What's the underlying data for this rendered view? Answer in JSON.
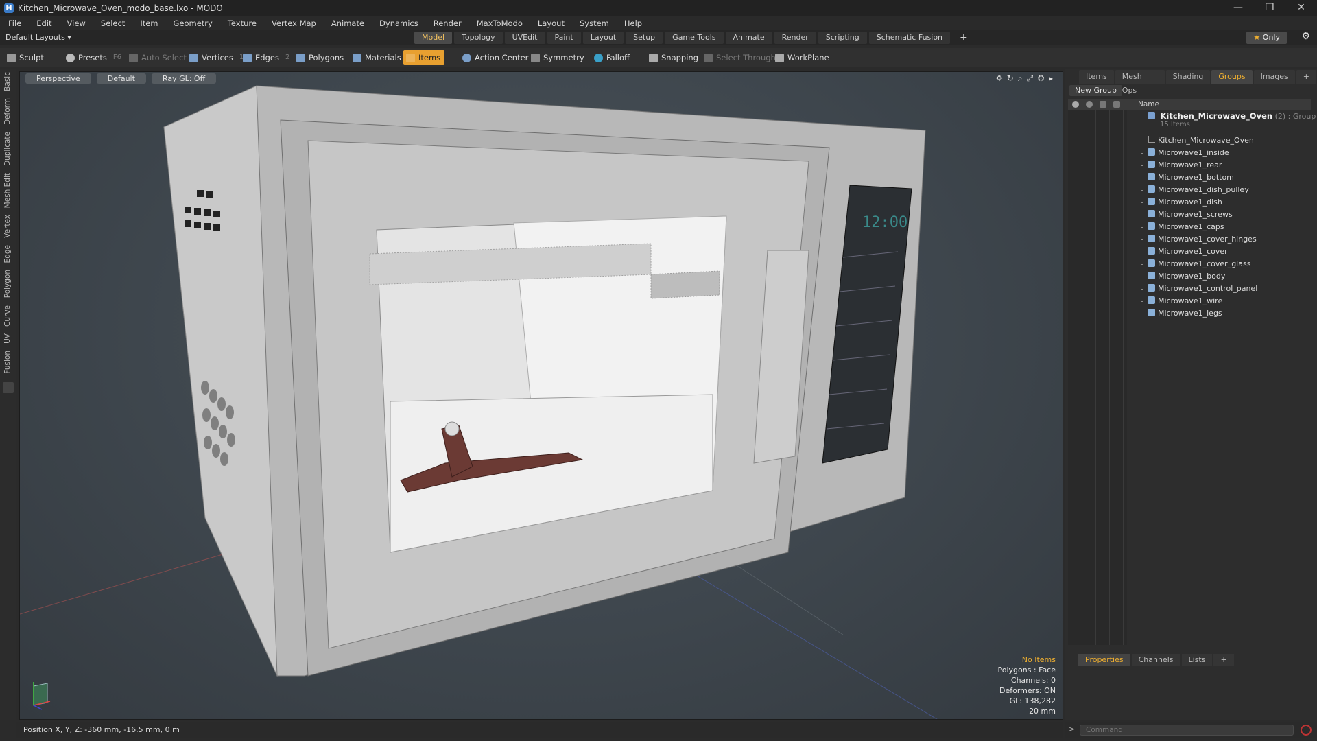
{
  "titlebar": {
    "title": "Kitchen_Microwave_Oven_modo_base.lxo - MODO",
    "min": "—",
    "max": "❐",
    "close": "✕"
  },
  "menubar": [
    "File",
    "Edit",
    "View",
    "Select",
    "Item",
    "Geometry",
    "Texture",
    "Vertex Map",
    "Animate",
    "Dynamics",
    "Render",
    "MaxToModo",
    "Layout",
    "System",
    "Help"
  ],
  "layoutbar": {
    "layout_select": "Default Layouts ▾",
    "tabs": [
      "Model",
      "Topology",
      "UVEdit",
      "Paint",
      "Layout",
      "Setup",
      "Game Tools",
      "Animate",
      "Render",
      "Scripting",
      "Schematic Fusion"
    ],
    "active_tab": "Model",
    "add": "+",
    "only_star": "★",
    "only_label": "Only",
    "gear": "⚙"
  },
  "toolbar": {
    "sculpt": "Sculpt",
    "presets": "Presets",
    "presets_key": "F6",
    "auto_select": "Auto Select",
    "vertices": "Vertices",
    "vertices_key": "1",
    "edges": "Edges",
    "edges_key": "2",
    "polygons": "Polygons",
    "materials": "Materials",
    "items": "Items",
    "action_center": "Action Center",
    "symmetry": "Symmetry",
    "falloff": "Falloff",
    "snapping": "Snapping",
    "select_through": "Select Through",
    "workplane": "WorkPlane"
  },
  "left_tabs": [
    "Basic",
    "Deform",
    "Duplicate",
    "Mesh Edit",
    "Vertex",
    "Edge",
    "Polygon",
    "Curve",
    "UV",
    "Fusion"
  ],
  "viewport": {
    "view": "Perspective",
    "shading": "Default",
    "raygl": "Ray GL: Off",
    "icons": [
      "✥",
      "↻",
      "⌕",
      "⤢",
      "⚙",
      "▸"
    ],
    "display_clock": "12:00",
    "stats": {
      "selection": "No Items",
      "polygons": "Polygons : Face",
      "channels": "Channels: 0",
      "deformers": "Deformers: ON",
      "gl": "GL: 138,282",
      "scale": "20 mm"
    }
  },
  "statusbar": {
    "position": "Position X, Y, Z:  -360 mm, -16.5 mm, 0 m"
  },
  "right_panel": {
    "tabs": [
      "Items",
      "Mesh Ops",
      "Shading",
      "Groups",
      "Images",
      "+"
    ],
    "active_tab": "Groups",
    "new_group": "New Group",
    "column_name": "Name",
    "group": {
      "name": "Kitchen_Microwave_Oven",
      "count_suffix": "(2)",
      "type": ": Group",
      "items": "15 Items"
    },
    "items": [
      "Kitchen_Microwave_Oven",
      "Microwave1_inside",
      "Microwave1_rear",
      "Microwave1_bottom",
      "Microwave1_dish_pulley",
      "Microwave1_dish",
      "Microwave1_screws",
      "Microwave1_caps",
      "Microwave1_cover_hinges",
      "Microwave1_cover",
      "Microwave1_cover_glass",
      "Microwave1_body",
      "Microwave1_control_panel",
      "Microwave1_wire",
      "Microwave1_legs"
    ]
  },
  "properties_panel": {
    "tabs": [
      "Properties",
      "Channels",
      "Lists",
      "+"
    ],
    "active_tab": "Properties"
  },
  "command": {
    "arrow": ">",
    "placeholder": "Command"
  }
}
